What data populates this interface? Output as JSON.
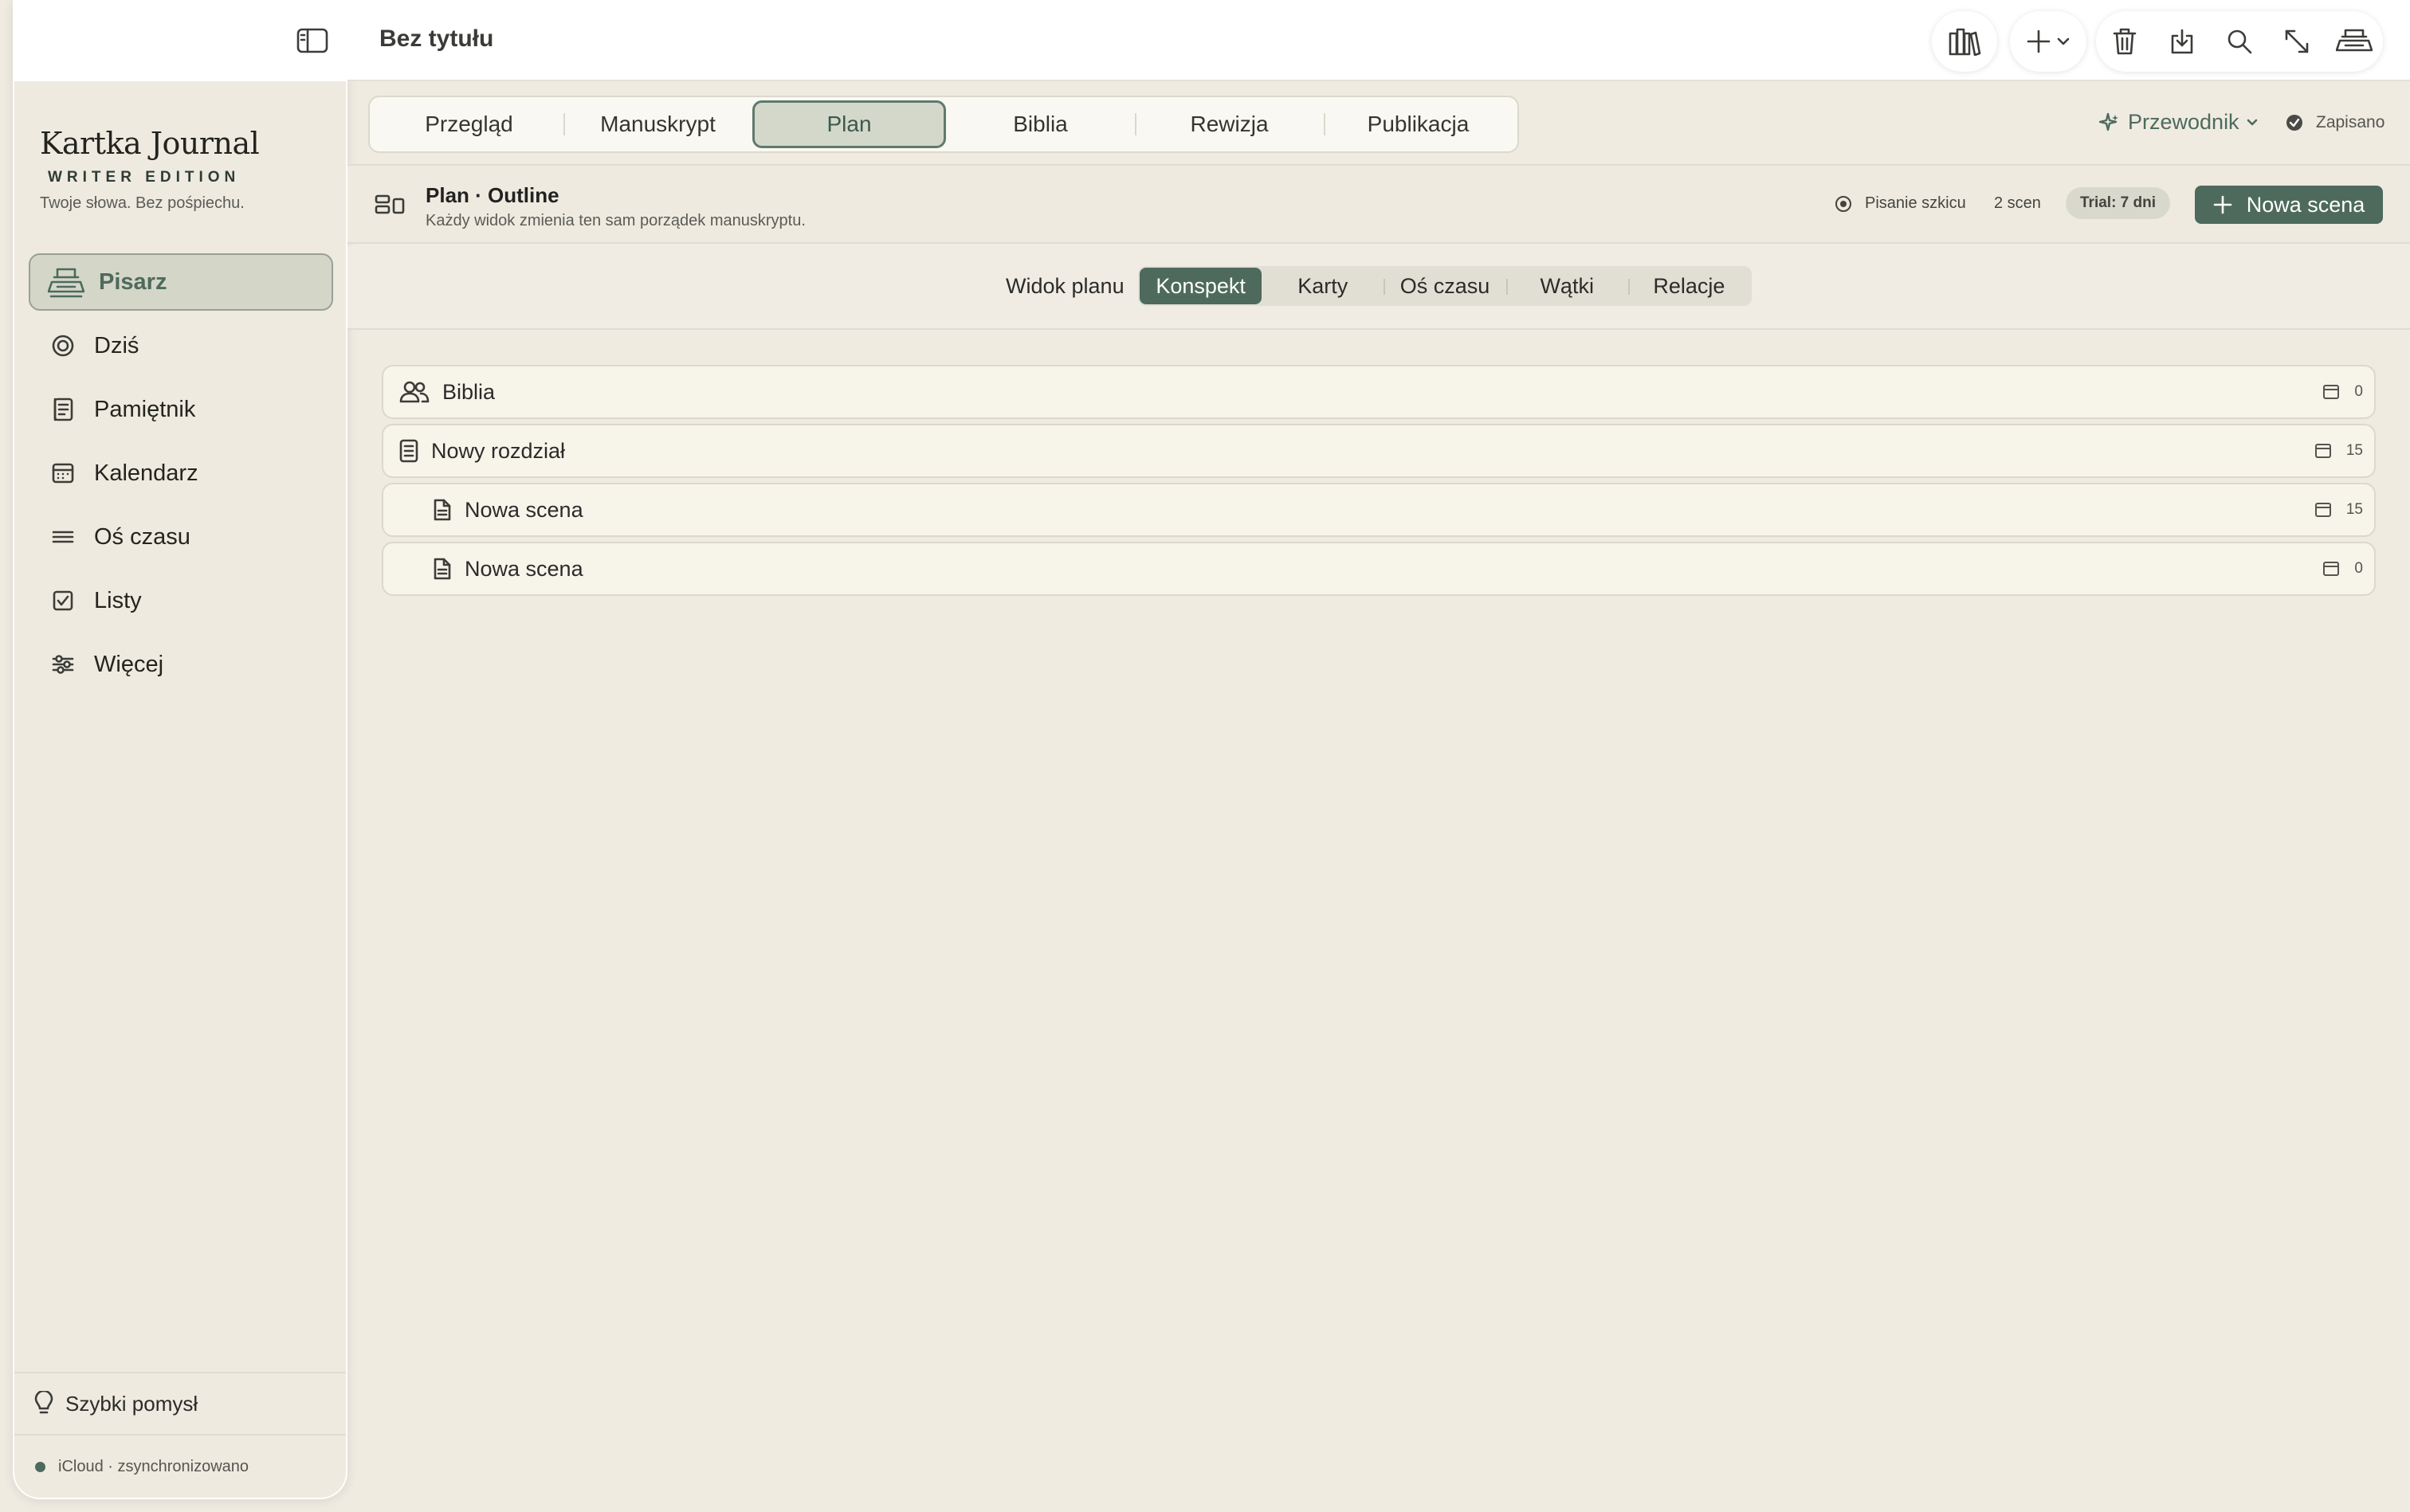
{
  "window": {
    "title": "Bez tytułu"
  },
  "brand": {
    "name": "Kartka Journal",
    "edition": "WRITER EDITION",
    "tagline": "Twoje słowa. Bez pośpiechu."
  },
  "sidebar": {
    "items": [
      {
        "label": "Pisarz",
        "icon": "typewriter-icon",
        "active": true
      },
      {
        "label": "Dziś",
        "icon": "target-icon"
      },
      {
        "label": "Pamiętnik",
        "icon": "journal-icon"
      },
      {
        "label": "Kalendarz",
        "icon": "calendar-icon"
      },
      {
        "label": "Oś czasu",
        "icon": "lines-icon"
      },
      {
        "label": "Listy",
        "icon": "checkbox-icon"
      },
      {
        "label": "Więcej",
        "icon": "sliders-icon"
      }
    ],
    "quick_idea": "Szybki pomysł",
    "sync_status": "iCloud · zsynchronizowano"
  },
  "toolbar": {
    "icons": [
      "library-icon",
      "plus-icon",
      "chevron-down-icon",
      "trash-icon",
      "export-icon",
      "search-icon",
      "expand-icon",
      "typewriter-icon"
    ]
  },
  "tabs": [
    {
      "label": "Przegląd"
    },
    {
      "label": "Manuskrypt"
    },
    {
      "label": "Plan",
      "active": true
    },
    {
      "label": "Biblia"
    },
    {
      "label": "Rewizja"
    },
    {
      "label": "Publikacja"
    }
  ],
  "guide": {
    "label": "Przewodnik"
  },
  "save_status": "Zapisano",
  "plan": {
    "title": "Plan · Outline",
    "subtitle": "Każdy widok zmienia ten sam porządek manuskryptu.",
    "status": "Pisanie szkicu",
    "scene_count": "2 scen",
    "trial": "Trial: 7 dni",
    "new_scene": "Nowa scena"
  },
  "view": {
    "label": "Widok planu",
    "options": [
      {
        "label": "Konspekt",
        "active": true
      },
      {
        "label": "Karty"
      },
      {
        "label": "Oś czasu"
      },
      {
        "label": "Wątki"
      },
      {
        "label": "Relacje"
      }
    ]
  },
  "outline": [
    {
      "label": "Biblia",
      "icon": "people-icon",
      "level": 0,
      "count": "0"
    },
    {
      "label": "Nowy rozdział",
      "icon": "chapter-icon",
      "level": 0,
      "count": "15"
    },
    {
      "label": "Nowa scena",
      "icon": "document-icon",
      "level": 1,
      "count": "15"
    },
    {
      "label": "Nowa scena",
      "icon": "document-icon",
      "level": 1,
      "count": "0"
    }
  ],
  "colors": {
    "accent": "#4d6a5d",
    "background": "#efebe1",
    "card": "#f7f4ea",
    "active_tab": "#d4d8cb"
  }
}
